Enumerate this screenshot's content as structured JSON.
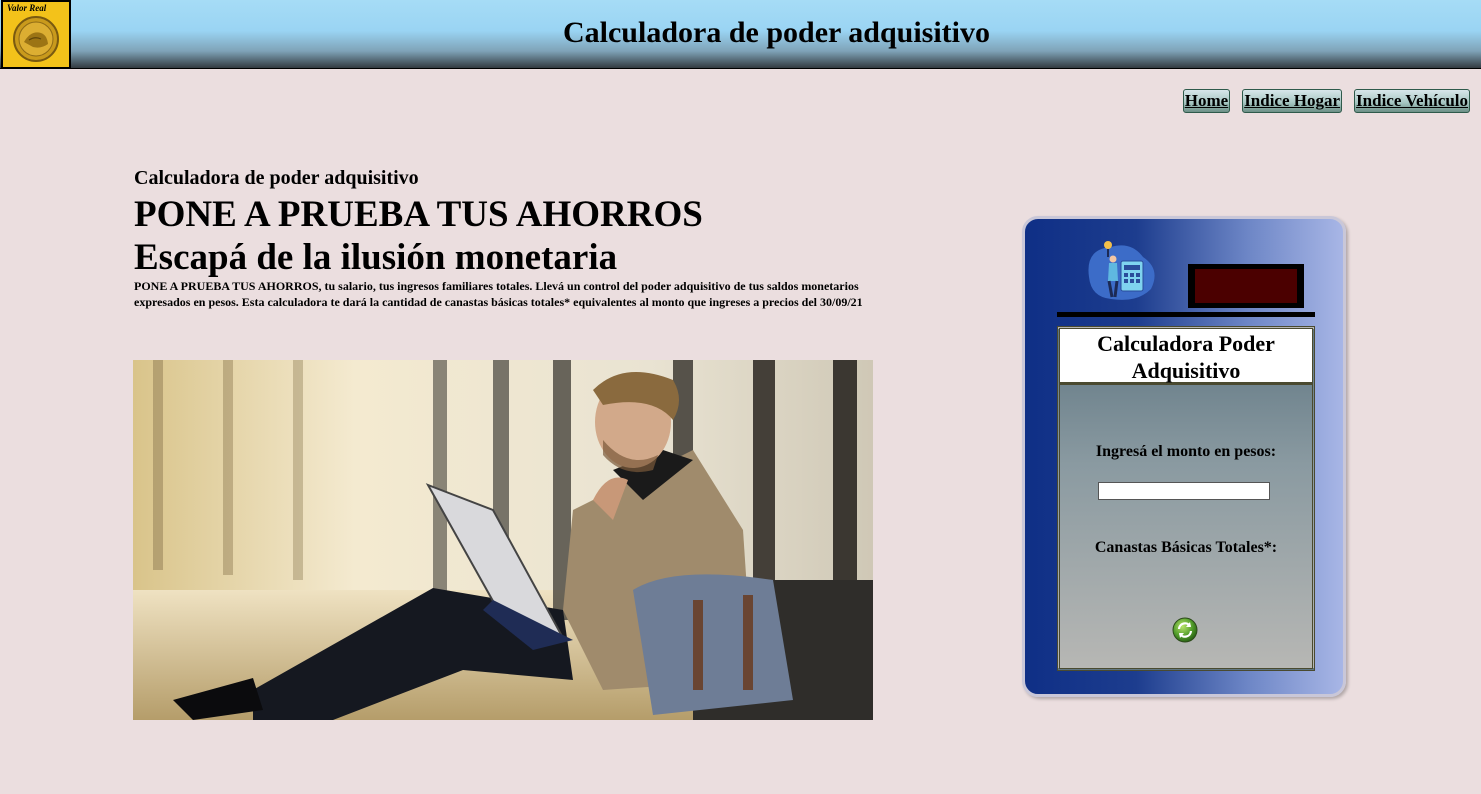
{
  "header": {
    "title": "Calculadora de poder adquisitivo",
    "logo_text": "Valor Real"
  },
  "nav": {
    "home": "Home",
    "indice_hogar": "Indice Hogar",
    "indice_vehiculo": "Indice Vehículo"
  },
  "intro": {
    "kicker": "Calculadora de poder adquisitivo",
    "headline": "PONE A PRUEBA TUS AHORROS",
    "subheadline": "Escapá de la ilusión monetaria",
    "description": "PONE A PRUEBA TUS AHORROS, tu salario, tus ingresos familiares totales. Llevá un control del poder adquisitivo de tus saldos monetarios expresados en pesos. Esta calculadora te dará la cantidad de canastas básicas totales* equivalentes al monto que ingreses a precios del 30/09/21"
  },
  "calculator": {
    "title": "Calculadora Poder Adquisitivo",
    "amount_label": "Ingresá el monto en pesos:",
    "amount_value": "",
    "result_label": "Canastas Básicas Totales*:",
    "display_value": ""
  },
  "colors": {
    "background": "#ebdedf",
    "calc_dark": "#0f2f86",
    "calc_light": "#a8b6e6",
    "nav_button": "#a9c9c5"
  },
  "icons": {
    "refresh": "refresh-icon",
    "calculator_illustration": "person-calculator-illustration",
    "logo": "gold-coin-logo"
  }
}
